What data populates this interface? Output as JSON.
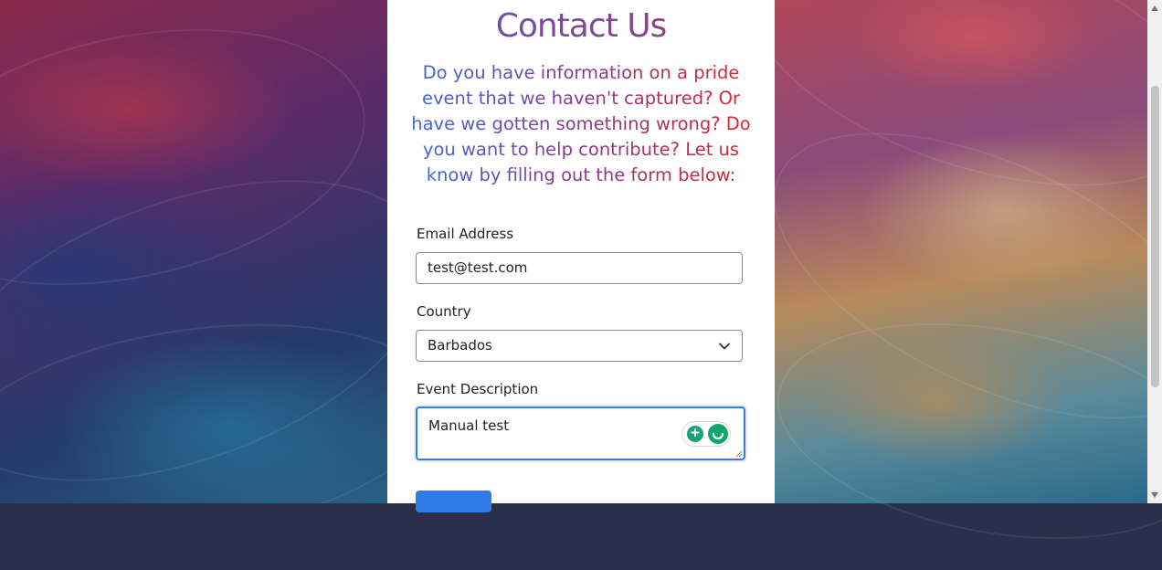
{
  "page": {
    "title": "Contact Us",
    "intro": "Do you have information on a pride event that we haven't captured? Or have we gotten something wrong? Do you want to help contribute? Let us know by filling out the form below:"
  },
  "form": {
    "email_label": "Email Address",
    "email_value": "test@test.com",
    "country_label": "Country",
    "country_value": "Barbados",
    "description_label": "Event Description",
    "description_value": "Manual test"
  },
  "icons": {
    "dropdown": "chevron-down-icon",
    "grammar_bulb": "lightbulb-icon",
    "grammar_logo": "grammar-assistant-icon"
  },
  "colors": {
    "title_gradient_start": "#5a5ac8",
    "title_gradient_end": "#a0386a",
    "focus_border": "#3a7ce0",
    "submit_button": "#2f7be8",
    "grammar_green": "#15a46f"
  }
}
